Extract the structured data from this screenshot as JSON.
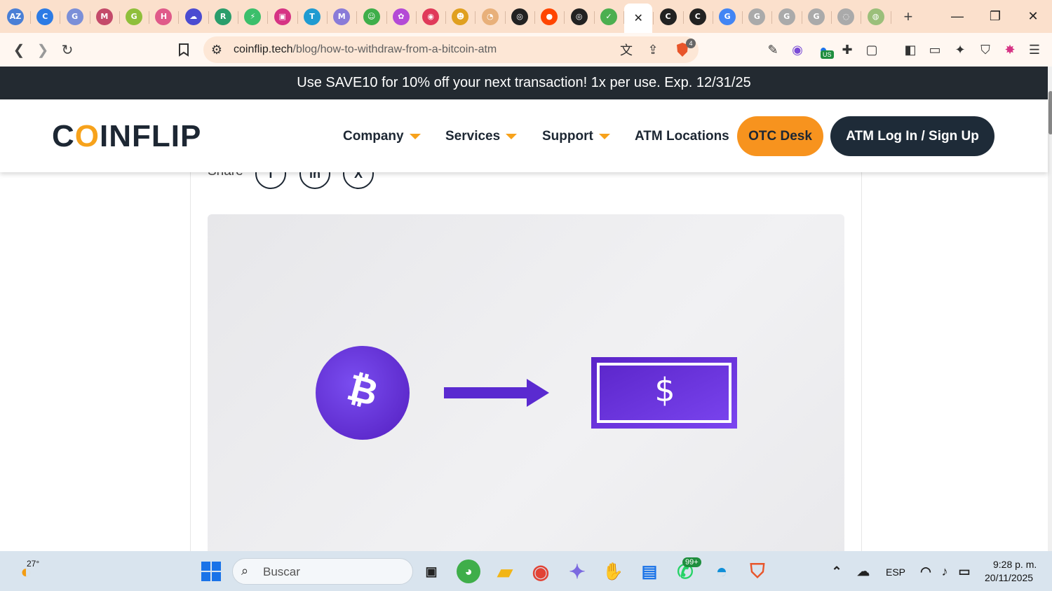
{
  "browser": {
    "tabs": [
      {
        "name": "AZ",
        "color": "#4a7fd6"
      },
      {
        "name": "C",
        "color": "#2c7be5"
      },
      {
        "name": "G",
        "color": "#7b8fd8"
      },
      {
        "name": "M",
        "color": "#c44a6a"
      },
      {
        "name": "G",
        "color": "#8fbf3a"
      },
      {
        "name": "H",
        "color": "#e05a8a"
      },
      {
        "name": "☁",
        "color": "#4b4bd1"
      },
      {
        "name": "R",
        "color": "#2a9d6b"
      },
      {
        "name": "⚡",
        "color": "#3bbf6b"
      },
      {
        "name": "▣",
        "color": "#d63384"
      },
      {
        "name": "T",
        "color": "#1f9bd1"
      },
      {
        "name": "M",
        "color": "#8a7bd8"
      },
      {
        "name": "☺",
        "color": "#3fae4a"
      },
      {
        "name": "✿",
        "color": "#b44ad6"
      },
      {
        "name": "◉",
        "color": "#e03a5a"
      },
      {
        "name": "☻",
        "color": "#e0a020"
      },
      {
        "name": "◔",
        "color": "#e8b07a"
      },
      {
        "name": "◎",
        "color": "#222222"
      },
      {
        "name": "●",
        "color": "#ff4500"
      },
      {
        "name": "◎",
        "color": "#222222"
      },
      {
        "name": "✓",
        "color": "#4caf50"
      },
      {
        "name": "✕",
        "color": "#222222"
      },
      {
        "name": "C",
        "color": "#222222"
      },
      {
        "name": "C",
        "color": "#222222"
      },
      {
        "name": "G",
        "color": "#4285f4"
      },
      {
        "name": "G",
        "color": "#aaaaaa"
      },
      {
        "name": "G",
        "color": "#aaaaaa"
      },
      {
        "name": "G",
        "color": "#aaaaaa"
      },
      {
        "name": "◌",
        "color": "#aaaaaa"
      },
      {
        "name": "◍",
        "color": "#9bbf7a"
      }
    ],
    "new_tab": "+",
    "url_host": "coinflip.tech",
    "url_path": "/blog/how-to-withdraw-from-a-bitcoin-atm",
    "brave_badge": "4",
    "vpn_badge": "US"
  },
  "site": {
    "promo": "Use SAVE10 for 10% off your next transaction! 1x per use. Exp. 12/31/25",
    "logo": {
      "pre": "C",
      "o": "O",
      "post": "INFLIP"
    },
    "menu": {
      "company": "Company",
      "services": "Services",
      "support": "Support",
      "atm_locations": "ATM Locations"
    },
    "otc": "OTC Desk",
    "atm_login": "ATM Log In / Sign Up",
    "share": {
      "label": "Share",
      "facebook": "f",
      "linkedin": "in",
      "x": "X"
    },
    "hero": {
      "bitcoin_symbol": "₿",
      "dollar_symbol": "$"
    }
  },
  "taskbar": {
    "weather": "27°",
    "search_placeholder": "Buscar",
    "whatsapp_badge": "99+",
    "lang": "ESP",
    "time": "9:28 p. m.",
    "date": "20/11/2025"
  }
}
